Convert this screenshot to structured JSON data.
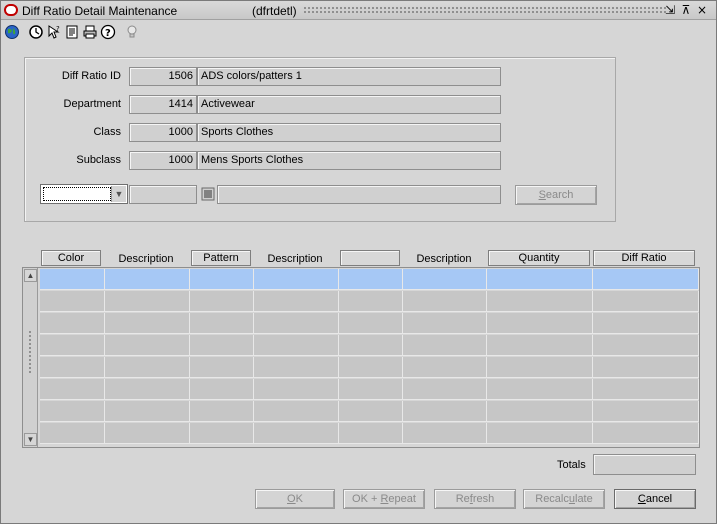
{
  "window": {
    "title": "Diff Ratio Detail Maintenance",
    "form_name": "(dfrtdetl)",
    "controls": [
      "⇲",
      "⊼",
      "×"
    ]
  },
  "toolbar": {
    "icons": [
      "globe-icon",
      "clock-icon",
      "help-pointer-icon",
      "notes-icon",
      "print-icon",
      "question-icon",
      "lightbulb-icon"
    ]
  },
  "header": {
    "diff_ratio_id": {
      "label": "Diff Ratio ID",
      "code": "1506",
      "desc": "ADS colors/patters 1"
    },
    "department": {
      "label": "Department",
      "code": "1414",
      "desc": "Activewear"
    },
    "class": {
      "label": "Class",
      "code": "1000",
      "desc": "Sports Clothes"
    },
    "subclass": {
      "label": "Subclass",
      "code": "1000",
      "desc": "Mens Sports Clothes"
    }
  },
  "search": {
    "combo_value": "",
    "code_value": "",
    "desc_value": "",
    "button_label": "Search",
    "button_mnemonic": "S",
    "button_rest": "earch"
  },
  "grid": {
    "columns": [
      {
        "label": "Color",
        "kind": "button"
      },
      {
        "label": "Description",
        "kind": "text"
      },
      {
        "label": "Pattern",
        "kind": "button"
      },
      {
        "label": "Description",
        "kind": "text"
      },
      {
        "label": "",
        "kind": "button"
      },
      {
        "label": "Description",
        "kind": "text"
      },
      {
        "label": "Quantity",
        "kind": "button"
      },
      {
        "label": "Diff Ratio",
        "kind": "button"
      }
    ],
    "row_count": 8,
    "selected_row": 0
  },
  "totals": {
    "label": "Totals",
    "value": ""
  },
  "buttons": {
    "ok": {
      "pre": "",
      "mn": "O",
      "post": "K",
      "enabled": false
    },
    "ok_repeat": {
      "pre": "OK + ",
      "mn": "R",
      "post": "epeat",
      "enabled": false
    },
    "refresh": {
      "pre": "Re",
      "mn": "f",
      "post": "resh",
      "enabled": false
    },
    "recalculate": {
      "pre": "Recalc",
      "mn": "u",
      "post": "late",
      "enabled": false
    },
    "cancel": {
      "pre": "",
      "mn": "C",
      "post": "ancel",
      "enabled": true
    }
  }
}
